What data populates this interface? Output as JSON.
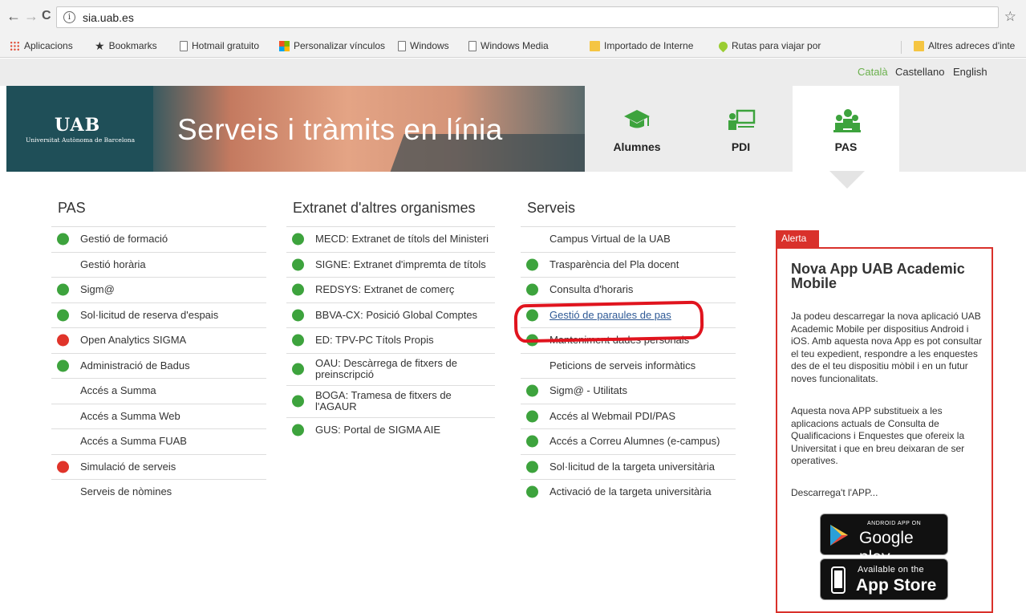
{
  "browser": {
    "url": "sia.uab.es",
    "back_icon": "←",
    "forward_icon": "→",
    "reload_icon": "C",
    "info_icon": "i",
    "star_icon": "☆",
    "bookmarks": [
      {
        "label": "Aplicacions",
        "icon": "apps-grid-icon"
      },
      {
        "label": "Bookmarks",
        "icon": "star-icon"
      },
      {
        "label": "Hotmail gratuito",
        "icon": "page-icon"
      },
      {
        "label": "Personalizar vínculos",
        "icon": "windows-icon"
      },
      {
        "label": "Windows",
        "icon": "page-icon"
      },
      {
        "label": "Windows Media",
        "icon": "page-icon"
      },
      {
        "label": "Importado de Interne",
        "icon": "folder-icon"
      },
      {
        "label": "Rutas para viajar por",
        "icon": "pin-icon"
      },
      {
        "label": "Altres adreces d'inte",
        "icon": "folder-icon"
      }
    ]
  },
  "languages": {
    "catala": "Català",
    "castellano": "Castellano",
    "english": "English"
  },
  "banner": {
    "logo": "UAB",
    "logo_sub": "Universitat Autònoma de Barcelona",
    "title": "Serveis i tràmits en línia",
    "roles": [
      {
        "label": "Alumnes",
        "icon": "graduation-cap-icon"
      },
      {
        "label": "PDI",
        "icon": "teacher-board-icon"
      },
      {
        "label": "PAS",
        "icon": "staff-group-icon",
        "active": true
      }
    ]
  },
  "columns": {
    "pas": {
      "title": "PAS",
      "items": [
        {
          "label": "Gestió de formació",
          "status": "green"
        },
        {
          "label": "Gestió horària",
          "status": "none"
        },
        {
          "label": "Sigm@",
          "status": "green"
        },
        {
          "label": "Sol·licitud de reserva d'espais",
          "status": "green"
        },
        {
          "label": "Open Analytics SIGMA",
          "status": "red"
        },
        {
          "label": "Administració de Badus",
          "status": "green"
        },
        {
          "label": "Accés a Summa",
          "status": "none"
        },
        {
          "label": "Accés a Summa Web",
          "status": "none"
        },
        {
          "label": "Accés a Summa FUAB",
          "status": "none"
        },
        {
          "label": "Simulació de serveis",
          "status": "red"
        },
        {
          "label": "Serveis de nòmines",
          "status": "none"
        }
      ]
    },
    "extranet": {
      "title": "Extranet d'altres organismes",
      "items": [
        {
          "label": "MECD: Extranet de títols del Ministeri",
          "status": "green"
        },
        {
          "label": "SIGNE: Extranet d'impremta de títols",
          "status": "green"
        },
        {
          "label": "REDSYS: Extranet de comerç",
          "status": "green"
        },
        {
          "label": "BBVA-CX: Posició Global Comptes",
          "status": "green"
        },
        {
          "label": "ED: TPV-PC Títols Propis",
          "status": "green"
        },
        {
          "label": "OAU: Descàrrega de fitxers de preinscripció",
          "status": "green"
        },
        {
          "label": "BOGA: Tramesa de fitxers de l'AGAUR",
          "status": "green"
        },
        {
          "label": "GUS: Portal de SIGMA AIE",
          "status": "green"
        }
      ]
    },
    "serveis": {
      "title": "Serveis",
      "items": [
        {
          "label": "Campus Virtual de la UAB",
          "status": "none"
        },
        {
          "label": "Trasparència del Pla docent",
          "status": "green"
        },
        {
          "label": "Consulta d'horaris",
          "status": "green"
        },
        {
          "label": "Gestió de paraules de pas",
          "status": "green",
          "link": true
        },
        {
          "label": "Manteniment dades personals",
          "status": "green"
        },
        {
          "label": "Peticions de serveis informàtics",
          "status": "none"
        },
        {
          "label": "Sigm@ - Utilitats",
          "status": "green"
        },
        {
          "label": "Accés al Webmail PDI/PAS",
          "status": "green"
        },
        {
          "label": "Accés a Correu Alumnes (e-campus)",
          "status": "green"
        },
        {
          "label": "Sol·licitud de la targeta universitària",
          "status": "green"
        },
        {
          "label": "Activació de la targeta universitària",
          "status": "green"
        }
      ]
    }
  },
  "alert": {
    "tab": "Alerta",
    "title": "Nova App UAB Academic Mobile",
    "p1": "Ja podeu descarregar la nova aplicació UAB Academic Mobile per dispositius Android i iOS. Amb aquesta nova App es pot consultar el teu expedient, respondre a les enquestes des de el teu dispositiu mòbil i en un futur noves funcionalitats.",
    "p2": "Aquesta nova APP substitueix a les aplicacions actuals de Consulta de Qualificacions i Enquestes que ofereix la Universitat i que en breu deixaran de ser operatives.",
    "p3": "Descarrega't l'APP...",
    "google_small": "ANDROID APP ON",
    "google_big": "Google play",
    "apple_small": "Available on the",
    "apple_big": "App Store"
  }
}
